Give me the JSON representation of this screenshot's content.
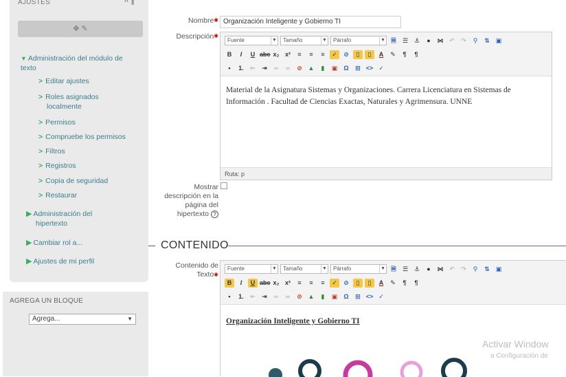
{
  "sidebar": {
    "settings_title": "AJUSTES",
    "header_controls": "^ ‖",
    "edit_controls": "✥ ✎",
    "module_admin": "Administración del módulo de texto",
    "module_items": [
      {
        "label": "Editar ajustes"
      },
      {
        "label": "Roles asignados localmente"
      },
      {
        "label": "Permisos"
      },
      {
        "label": "Compruebe los permisos"
      },
      {
        "label": "Filtros"
      },
      {
        "label": "Registros"
      },
      {
        "label": "Copia de seguridad"
      },
      {
        "label": "Restaurar"
      }
    ],
    "hypertext_admin": "Administración del hipertexto",
    "switch_role": "Cambiar rol a...",
    "profile_settings": "Ajustes de mi perfil",
    "add_block_title": "AGREGA UN BLOQUE",
    "add_block_select": "Agrega..."
  },
  "form": {
    "nombre_label": "Nombre",
    "nombre_value": "Organización Inteligente y Gobierno TI",
    "descripcion_label": "Descripción",
    "toolbar": {
      "font_select": "Fuente",
      "size_select": "Tamaño",
      "para_select": "Párrafo"
    },
    "descripcion_text": "Material de la Asignatura Sistemas y Organizaciones. Carrera Licenciatura en Sistemas de Información . Facultad de Ciencias Exactas, Naturales y Agrimensura. UNNE",
    "path_label": "Ruta: p",
    "mostrar_label_1": "Mostrar",
    "mostrar_label_2": "descripción en la",
    "mostrar_label_3": "página del",
    "mostrar_label_4": "hipertexto",
    "help_icon": "?",
    "section_title": "CONTENIDO",
    "contenido_label_1": "Contenido de",
    "contenido_label_2": "Texto",
    "contenido_text": "Organización Inteligente y Gobierno TI",
    "required_mark": "✱"
  },
  "watermark": {
    "line1": "Activar Window",
    "line2": "a Configuración de"
  },
  "colors": {
    "nav_link": "#3c7e8c",
    "nav_arrow": "#3cae5d",
    "section_line": "#7b5ea7",
    "required": "#cc0000"
  }
}
